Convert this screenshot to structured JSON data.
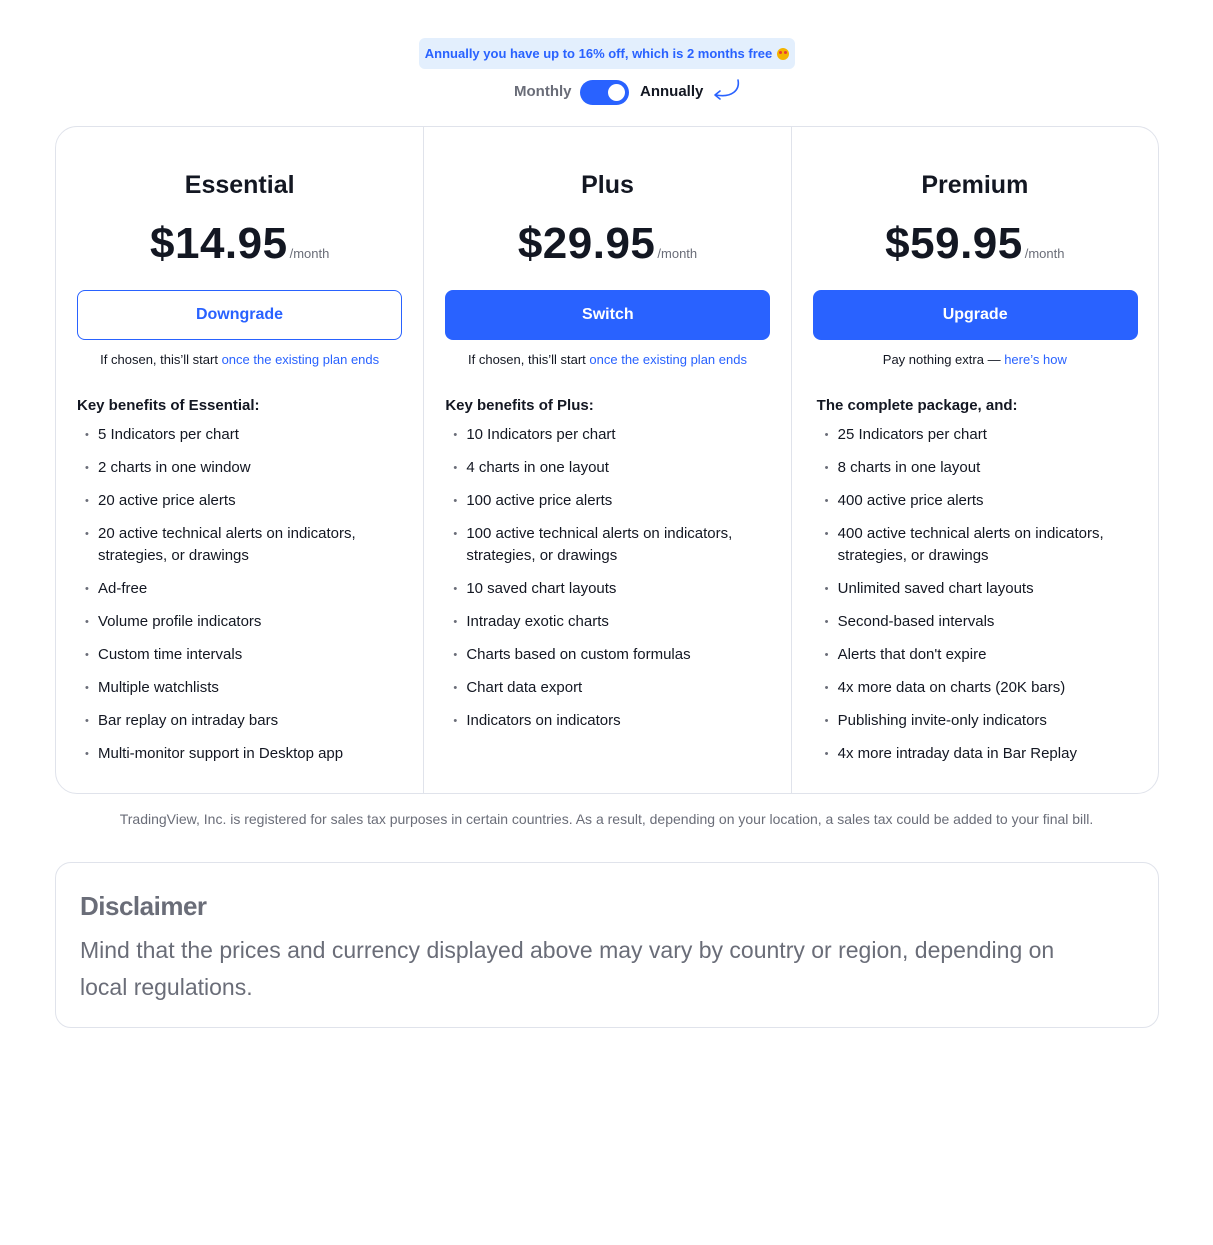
{
  "promo": {
    "text": "Annually you have up to 16% off, which is 2 months free"
  },
  "billing_toggle": {
    "monthly_label": "Monthly",
    "annually_label": "Annually",
    "selected": "Annually"
  },
  "plans": [
    {
      "name": "Essential",
      "price": "$14.95",
      "period": "/month",
      "button_label": "Downgrade",
      "note_prefix": "If chosen, this’ll start",
      "note_link": "once the existing plan ends",
      "benefits_heading": "Key benefits of Essential:",
      "benefits": [
        "5 Indicators per chart",
        "2 charts in one window",
        "20 active price alerts",
        "20 active technical alerts on indicators, strategies, or drawings",
        "Ad-free",
        "Volume profile indicators",
        "Custom time intervals",
        "Multiple watchlists",
        "Bar replay on intraday bars",
        "Multi-monitor support in Desktop app"
      ]
    },
    {
      "name": "Plus",
      "price": "$29.95",
      "period": "/month",
      "button_label": "Switch",
      "note_prefix": "If chosen, this’ll start",
      "note_link": "once the existing plan ends",
      "benefits_heading": "Key benefits of Plus:",
      "benefits": [
        "10 Indicators per chart",
        "4 charts in one layout",
        "100 active price alerts",
        "100 active technical alerts on indicators, strategies, or drawings",
        "10 saved chart layouts",
        "Intraday exotic charts",
        "Charts based on custom formulas",
        "Chart data export",
        "Indicators on indicators"
      ]
    },
    {
      "name": "Premium",
      "price": "$59.95",
      "period": "/month",
      "button_label": "Upgrade",
      "note_prefix": "Pay nothing extra —",
      "note_link": "here’s how",
      "benefits_heading": "The complete package, and:",
      "benefits": [
        "25 Indicators per chart",
        "8 charts in one layout",
        "400 active price alerts",
        "400 active technical alerts on indicators, strategies, or drawings",
        "Unlimited saved chart layouts",
        "Second-based intervals",
        "Alerts that don't expire",
        "4x more data on charts (20K bars)",
        "Publishing invite-only indicators",
        "4x more intraday data in Bar Replay"
      ]
    }
  ],
  "tax_note": "TradingView, Inc. is registered for sales tax purposes in certain countries. As a result, depending on your location, a sales tax could be added to your final bill.",
  "disclaimer": {
    "title": "Disclaimer",
    "text": "Mind that the prices and currency displayed above may vary by country or region, depending on local regulations."
  },
  "colors": {
    "accent": "#2962ff",
    "promo_bg": "#e3effd",
    "text": "#131722",
    "muted": "#6a6d78",
    "border": "#e0e3eb"
  }
}
